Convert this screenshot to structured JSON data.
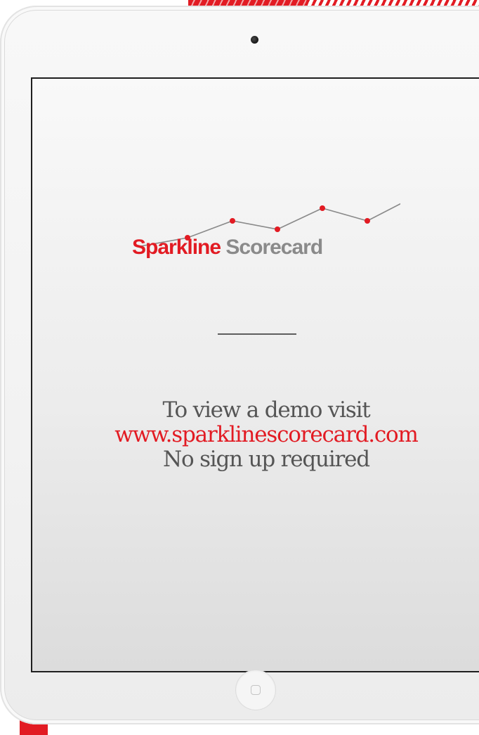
{
  "logo": {
    "word1": "Sparkline",
    "word2": "Scorecard",
    "sparkline_values": [
      1,
      3,
      2,
      4.5,
      3,
      6
    ],
    "brand_red": "#e21b23",
    "brand_grey": "#8a8a8a"
  },
  "message": {
    "line1": "To view a demo visit",
    "url": "www.sparklinescorecard.com",
    "line3": "No sign up required"
  },
  "icons": {
    "camera": "camera-dot",
    "home": "home-button-square"
  }
}
